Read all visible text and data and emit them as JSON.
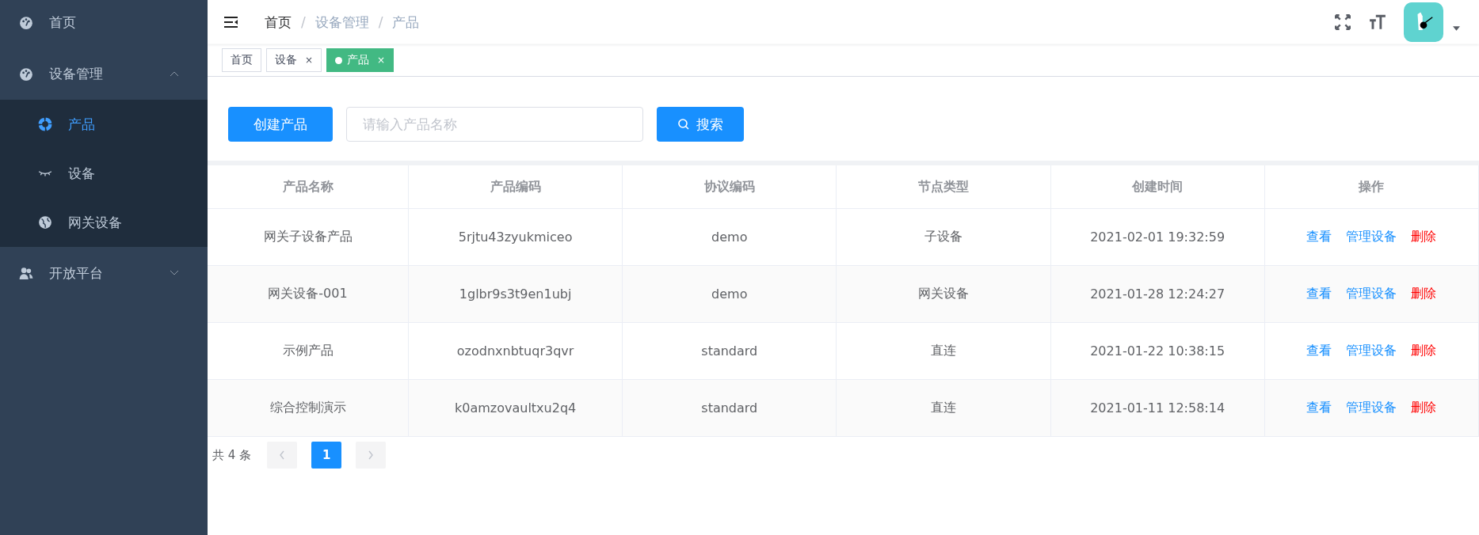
{
  "sidebar": {
    "items": [
      {
        "label": "首页",
        "kind": "link",
        "selected": false
      },
      {
        "label": "设备管理",
        "kind": "group",
        "expanded": true,
        "children": [
          {
            "label": "产品",
            "selected": true
          },
          {
            "label": "设备",
            "selected": false
          },
          {
            "label": "网关设备",
            "selected": false
          }
        ]
      },
      {
        "label": "开放平台",
        "kind": "group",
        "expanded": false
      }
    ]
  },
  "breadcrumb": [
    {
      "label": "首页"
    },
    {
      "separator": "/",
      "label": "设备管理"
    },
    {
      "separator": "/",
      "label": "产品"
    }
  ],
  "tabs": [
    {
      "label": "首页",
      "selected": false
    },
    {
      "label": "设备",
      "close": "×",
      "selected": false
    },
    {
      "label": "产品",
      "close": "×",
      "selected": true
    }
  ],
  "toolbar": {
    "create_button": "创建产品",
    "search": {
      "placeholder": "请输入产品名称"
    },
    "search_button": "搜索"
  },
  "table": {
    "columns": [
      "产品名称",
      "产品编码",
      "协议编码",
      "节点类型",
      "创建时间",
      "操作"
    ],
    "rows": [
      {
        "cells": [
          "网关子设备产品",
          "5rjtu43zyukmiceo",
          "demo",
          "子设备",
          "2021-02-01 19:32:59"
        ],
        "actions": [
          {
            "label": "查看",
            "kind": "normal"
          },
          {
            "label": "管理设备",
            "kind": "normal"
          },
          {
            "label": "删除",
            "kind": "danger"
          }
        ]
      },
      {
        "cells": [
          "网关设备-001",
          "1glbr9s3t9en1ubj",
          "demo",
          "网关设备",
          "2021-01-28 12:24:27"
        ],
        "actions": [
          {
            "label": "查看",
            "kind": "normal"
          },
          {
            "label": "管理设备",
            "kind": "normal"
          },
          {
            "label": "删除",
            "kind": "danger"
          }
        ]
      },
      {
        "cells": [
          "示例产品",
          "ozodnxnbtuqr3qvr",
          "standard",
          "直连",
          "2021-01-22 10:38:15"
        ],
        "actions": [
          {
            "label": "查看",
            "kind": "normal"
          },
          {
            "label": "管理设备",
            "kind": "normal"
          },
          {
            "label": "删除",
            "kind": "danger"
          }
        ]
      },
      {
        "cells": [
          "综合控制演示",
          "k0amzovaultxu2q4",
          "standard",
          "直连",
          "2021-01-11 12:58:14"
        ],
        "actions": [
          {
            "label": "查看",
            "kind": "normal"
          },
          {
            "label": "管理设备",
            "kind": "normal"
          },
          {
            "label": "删除",
            "kind": "danger"
          }
        ]
      }
    ]
  },
  "pagination": {
    "total": "共 4 条",
    "pages": [
      {
        "label": "1",
        "selected": true
      }
    ]
  }
}
